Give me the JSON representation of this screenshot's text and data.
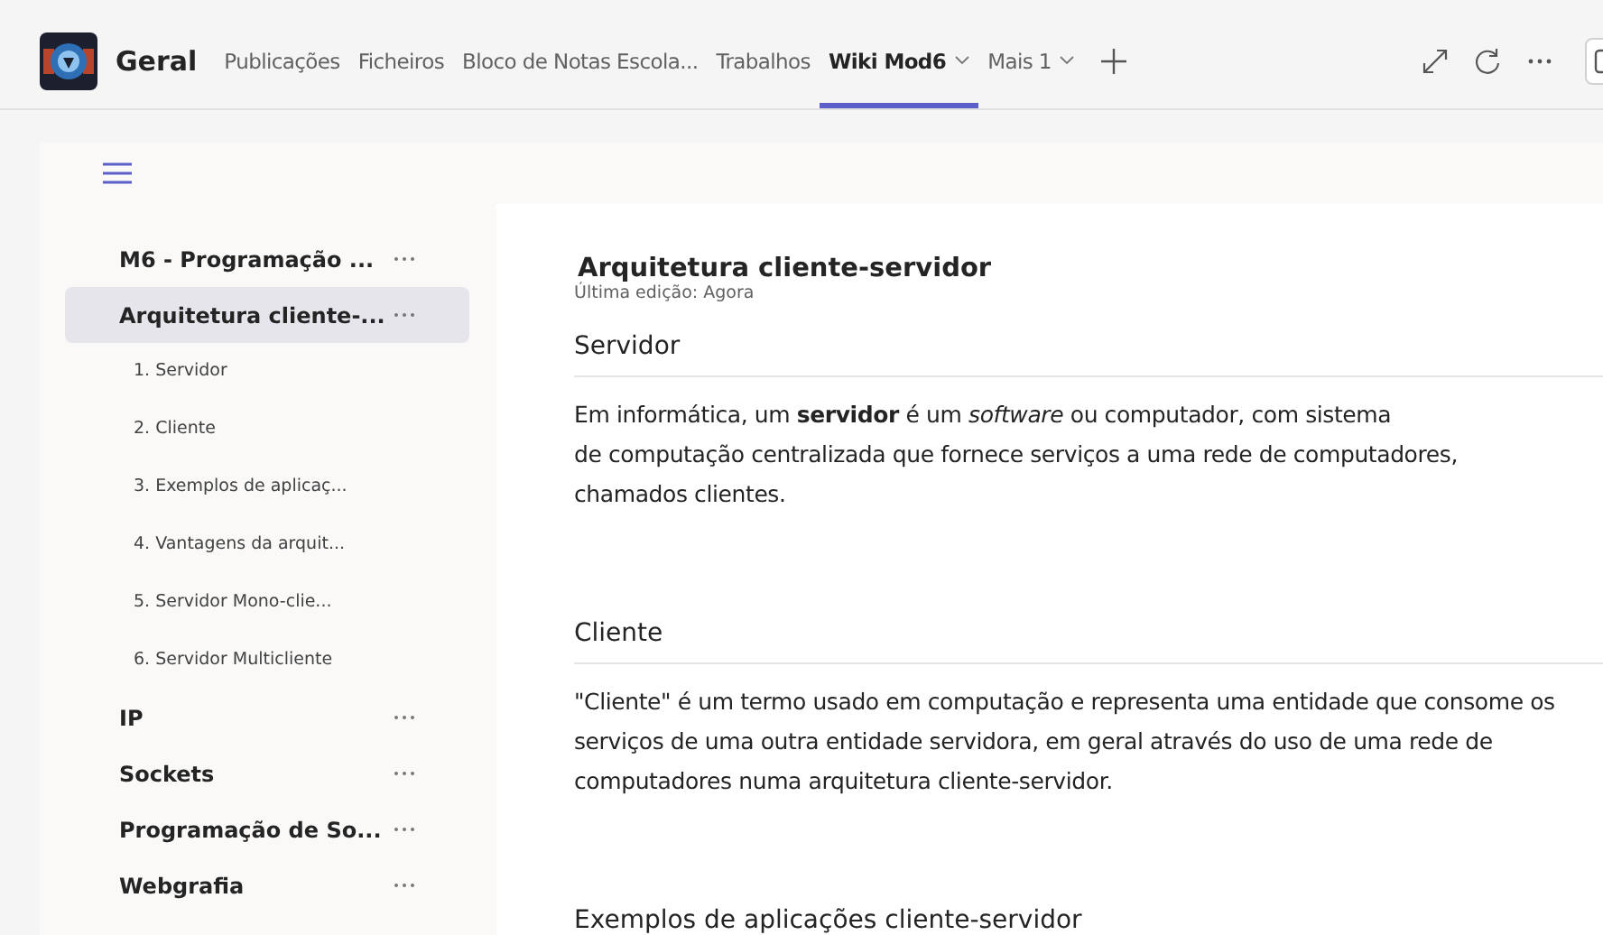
{
  "header": {
    "team": "Geral",
    "tabs": [
      {
        "label": "Publicações",
        "selected": false,
        "dropdown": false
      },
      {
        "label": "Ficheiros",
        "selected": false,
        "dropdown": false
      },
      {
        "label": "Bloco de Notas Escola...",
        "selected": false,
        "dropdown": false
      },
      {
        "label": "Trabalhos",
        "selected": false,
        "dropdown": false
      },
      {
        "label": "Wiki Mod6",
        "selected": true,
        "dropdown": true
      },
      {
        "label": "Mais 1",
        "selected": false,
        "dropdown": true
      }
    ]
  },
  "sidebar": {
    "items": [
      {
        "label": "M6 - Programação ...",
        "selected": false
      },
      {
        "label": "Arquitetura cliente-...",
        "selected": true,
        "children": [
          {
            "label": "1. Servidor"
          },
          {
            "label": "2. Cliente"
          },
          {
            "label": "3. Exemplos de aplicaç..."
          },
          {
            "label": "4. Vantagens da arquit..."
          },
          {
            "label": "5. Servidor Mono-clie..."
          },
          {
            "label": "6. Servidor Multicliente"
          }
        ]
      },
      {
        "label": "IP",
        "selected": false
      },
      {
        "label": "Sockets",
        "selected": false
      },
      {
        "label": "Programação de So...",
        "selected": false
      },
      {
        "label": "Webgrafia",
        "selected": false
      }
    ]
  },
  "page": {
    "title": "Arquitetura cliente-servidor",
    "last_edit": "Última edição: Agora",
    "sections": [
      {
        "heading": "Servidor",
        "text": "Em informática, um **servidor** é um *software* ou computador, com sistema\nde computação centralizada que fornece serviços a uma rede de computadores, chamados clientes."
      },
      {
        "heading": "Cliente",
        "text": "\"Cliente\" é um termo usado em computação e representa uma entidade que consome os serviços de uma outra entidade servidora, em geral através do uso de uma rede de computadores numa arquitetura cliente-servidor."
      },
      {
        "heading": "Exemplos de aplicações cliente-servidor"
      }
    ]
  }
}
